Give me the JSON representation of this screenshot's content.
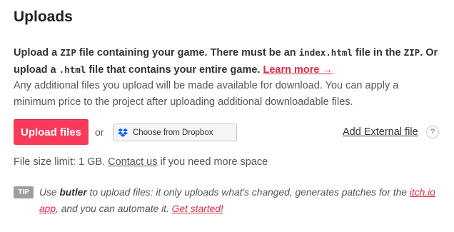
{
  "section": {
    "title": "Uploads"
  },
  "instructions": {
    "t1": "Upload a ",
    "code_zip1": "ZIP",
    "t2": " file containing your game. There must be an ",
    "code_index": "index.html",
    "t3": " file in the ",
    "code_zip2": "ZIP",
    "t4": ". Or upload a ",
    "code_html": ".html",
    "t5": " file that contains your entire game. ",
    "learn_more": "Learn more →"
  },
  "extra_files_text": "Any additional files you upload will be made available for download. You can apply a minimum price to the project after uploading additional downloadable files.",
  "actions": {
    "upload_label": "Upload files",
    "or_label": "or",
    "dropbox_label": "Choose from Dropbox",
    "external_label": "Add External file",
    "help_label": "?"
  },
  "limit": {
    "t1": "File size limit: 1 GB. ",
    "contact": "Contact us",
    "t2": " if you need more space"
  },
  "tip": {
    "badge": "TIP",
    "t1": "Use ",
    "butler": "butler",
    "t2": " to upload files: it only uploads what's changed, generates patches for the ",
    "itch_link": "itch.io app",
    "t3": ", and you can automate it. ",
    "get_started": "Get started!"
  },
  "colors": {
    "accent": "#fa3a5a",
    "link": "#da2c49",
    "dropbox": "#0061fe"
  },
  "icons": {
    "dropbox": "dropbox-icon",
    "help": "question-icon"
  }
}
